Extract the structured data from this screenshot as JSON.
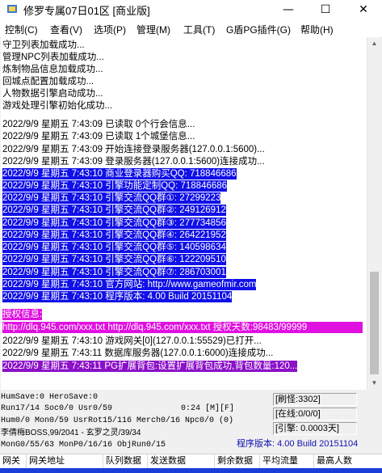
{
  "window": {
    "title": "修罗专属07日01区 [商业版]",
    "controls": {
      "minimize": "—",
      "maximize": "☐",
      "close": "✕"
    }
  },
  "menu": [
    "控制(C)",
    "查看(V)",
    "选项(P)",
    "管理(M)",
    "工具(T)",
    "G盾PG插件(G)",
    "帮助(H)"
  ],
  "log": [
    {
      "text": "守卫列表加载成功...",
      "style": "plain"
    },
    {
      "text": "管理NPC列表加载成功...",
      "style": "plain"
    },
    {
      "text": "炼制物品信息加载成功...",
      "style": "plain"
    },
    {
      "text": "回城点配置加载成功...",
      "style": "plain"
    },
    {
      "text": "人物数据引擎启动成功...",
      "style": "plain"
    },
    {
      "text": "游戏处理引擎初始化成功...",
      "style": "plain"
    },
    {
      "text": "2022/9/9 星期五 7:43:09 已读取 0个行会信息...",
      "style": "plain"
    },
    {
      "text": "2022/9/9 星期五 7:43:09 已读取 1个城堡信息...",
      "style": "plain"
    },
    {
      "text": "2022/9/9 星期五 7:43:09 开始连接登录服务器(127.0.0.1:5600)...",
      "style": "plain"
    },
    {
      "text": "2022/9/9 星期五 7:43:09 登录服务器(127.0.0.1:5600)连接成功...",
      "style": "plain"
    },
    {
      "text": "2022/9/9 星期五 7:43:10 商业登录器购买QQ: 718846686",
      "style": "blue"
    },
    {
      "text": "2022/9/9 星期五 7:43:10 引擎功能定制QQ: 718846686",
      "style": "blue"
    },
    {
      "text": "2022/9/9 星期五 7:43:10 引擎交流QQ群①: 27299223",
      "style": "blue"
    },
    {
      "text": "2022/9/9 星期五 7:43:10 引擎交流QQ群②: 249126912",
      "style": "blue"
    },
    {
      "text": "2022/9/9 星期五 7:43:10 引擎交流QQ群③: 277734856",
      "style": "blue"
    },
    {
      "text": "2022/9/9 星期五 7:43:10 引擎交流QQ群④: 264221952",
      "style": "blue"
    },
    {
      "text": "2022/9/9 星期五 7:43:10 引擎交流QQ群⑤: 140598634",
      "style": "blue"
    },
    {
      "text": "2022/9/9 星期五 7:43:10 引擎交流QQ群⑥: 122209510",
      "style": "blue"
    },
    {
      "text": "2022/9/9 星期五 7:43:10 引擎交流QQ群⑦: 286703001",
      "style": "blue"
    },
    {
      "text": "2022/9/9 星期五 7:43:10 官方网站: http://www.gameofmir.com",
      "style": "blue"
    },
    {
      "text": "2022/9/9 星期五 7:43:10 程序版本: 4.00 Build 20151104",
      "style": "blue"
    },
    {
      "text": "授权信息:",
      "style": "magenta"
    },
    {
      "text": "http://dlq.945.com/xxx.txt http://dlq.945.com/xxx.txt 授权天数:98483/99999",
      "style": "magenta"
    },
    {
      "text": "2022/9/9 星期五 7:43:10 游戏网关[0](127.0.0.1:55529)已打开...",
      "style": "plain"
    },
    {
      "text": "2022/9/9 星期五 7:43:11 数据库服务器(127.0.0.1:6000)连接成功...",
      "style": "plain"
    },
    {
      "text": "2022/9/9 星期五 7:43:11 PG扩展背包:设置扩展背包成功,背包数量:120...",
      "style": "purple"
    }
  ],
  "status": {
    "line1": "HumSave:0 HeroSave:0",
    "line2": "Run17/14 Soc0/0 Usr0/59",
    "line2b": "0:24 [M][F]",
    "line3": "Hum0/0 Mon0/59 UsrRot15/116 Merch0/16 Npc0/0 (0)",
    "line4": "李倩梅BOSS,99/2041 - 玄罗之灵/39/34",
    "line5": "MonG0/55/63 MonP0/16/16 ObjRun0/15",
    "refresh": "[刷怪:3302]",
    "online": "[在线:0/0/0]",
    "engine": "[引擎: 0.0003天]",
    "version": "程序版本: 4.00 Build 20151104"
  },
  "table": {
    "columns": [
      "网关",
      "网关地址",
      "队列数据",
      "发送数据",
      "剩余数据",
      "平均流量",
      "最高人数"
    ]
  }
}
